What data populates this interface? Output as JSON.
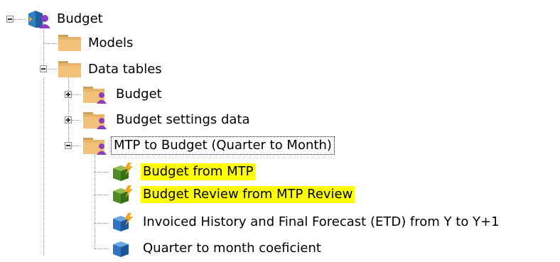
{
  "tree": {
    "root": {
      "label": "Budget",
      "icon": "budget-cube-user-icon"
    },
    "children": [
      {
        "label": "Models",
        "icon": "folder-icon"
      },
      {
        "label": "Data tables",
        "icon": "folder-icon",
        "expanded": true,
        "children": [
          {
            "label": "Budget",
            "icon": "folder-user-icon",
            "expanded": false
          },
          {
            "label": "Budget settings data",
            "icon": "folder-user-icon",
            "expanded": false
          },
          {
            "label": "MTP to Budget (Quarter to Month)",
            "icon": "folder-user-icon",
            "expanded": true,
            "focused": true,
            "children": [
              {
                "label": "Budget from MTP",
                "icon": "cube-lightning-green-icon",
                "highlight": "#ffff00"
              },
              {
                "label": "Budget Review from MTP Review",
                "icon": "cube-lightning-green-icon",
                "highlight": "#ffff00"
              },
              {
                "label": "Invoiced History and Final Forecast (ETD) from Y to Y+1",
                "icon": "cube-lightning-blue-icon"
              },
              {
                "label": "Quarter to month coeficient",
                "icon": "cube-blue-icon"
              }
            ]
          }
        ]
      }
    ]
  }
}
